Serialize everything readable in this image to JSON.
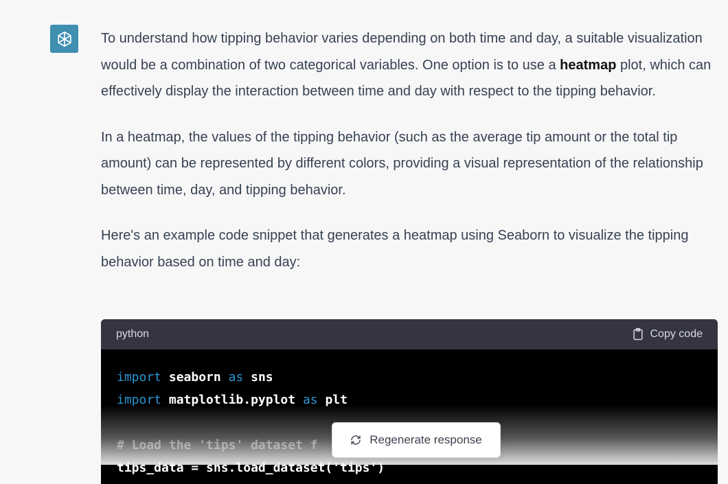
{
  "assistant": {
    "avatar_icon": "openai-logo-icon",
    "paragraphs": {
      "p1_before": "To understand how tipping behavior varies depending on both time and day, a suitable visualization would be a combination of two categorical variables. One option is to use a ",
      "p1_bold": "heatmap",
      "p1_after": " plot, which can effectively display the interaction between time and day with respect to the tipping behavior.",
      "p2": "In a heatmap, the values of the tipping behavior (such as the average tip amount or the total tip amount) can be represented by different colors, providing a visual representation of the relationship between time, day, and tipping behavior.",
      "p3": "Here's an example code snippet that generates a heatmap using Seaborn to visualize the tipping behavior based on time and day:"
    }
  },
  "code_block": {
    "language": "python",
    "copy_label": "Copy code",
    "lines": {
      "l1_kw": "import",
      "l1_mod": " seaborn ",
      "l1_as": "as",
      "l1_alias": " sns",
      "l2_kw": "import",
      "l2_mod": " matplotlib.pyplot ",
      "l2_as": "as",
      "l2_alias": " plt",
      "l3_comment": "# Load the 'tips' dataset f",
      "l4_partial": "tips_data = sns.load_dataset('tips')"
    }
  },
  "regenerate": {
    "label": "Regenerate response",
    "icon": "refresh-icon"
  },
  "colors": {
    "background": "#f7f7f8",
    "avatar": "#3e8fb0",
    "code_header": "#343541",
    "keyword": "#2e95d3"
  }
}
